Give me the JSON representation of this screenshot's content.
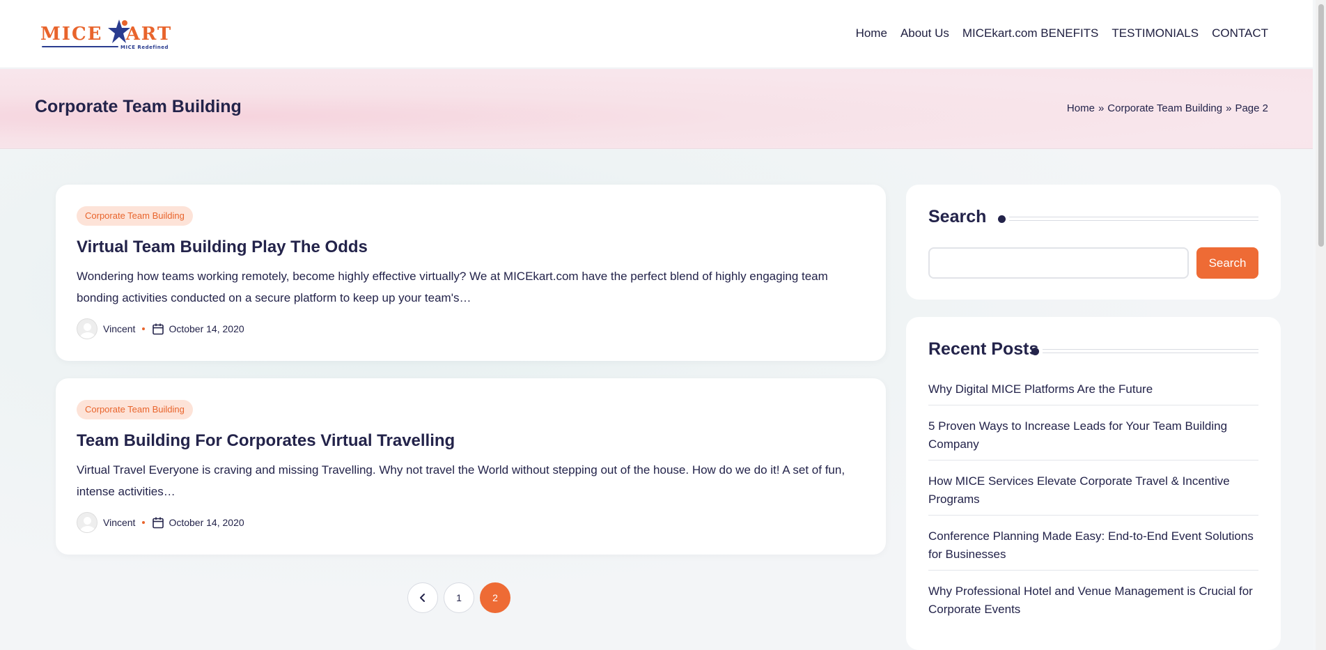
{
  "brand": {
    "logo_text": "MICE",
    "logo_text_end": "ART",
    "logo_tagline": "MICE Redefined",
    "accent": "#ee6b35",
    "dark": "#23234a"
  },
  "nav": {
    "items": [
      "Home",
      "About Us",
      "MICEkart.com BENEFITS",
      "TESTIMONIALS",
      "CONTACT"
    ]
  },
  "banner": {
    "title": "Corporate Team Building",
    "breadcrumb": [
      "Home",
      "»",
      "Corporate Team Building",
      "»",
      "Page 2"
    ]
  },
  "posts": [
    {
      "category": "Corporate Team Building",
      "title": "Virtual Team Building Play The Odds",
      "excerpt": "Wondering how teams working remotely, become highly effective virtually? We at MICEkart.com have the perfect blend of highly engaging team bonding activities conducted on a secure platform to keep up your team's…",
      "author": "Vincent",
      "date": "October 14, 2020"
    },
    {
      "category": "Corporate Team Building",
      "title": "Team Building For Corporates Virtual Travelling",
      "excerpt": "Virtual Travel Everyone is craving and missing Travelling. Why not travel the World without stepping out of the house. How do we do it! A set of fun, intense activities…",
      "author": "Vincent",
      "date": "October 14, 2020"
    }
  ],
  "pagination": {
    "pages": [
      "1",
      "2"
    ],
    "current": "2",
    "prev_icon": "chevron-left-icon"
  },
  "sidebar": {
    "search": {
      "title": "Search",
      "placeholder": "",
      "button_label": "Search"
    },
    "recent": {
      "title": "Recent Posts",
      "items": [
        "Why Digital MICE Platforms Are the Future",
        "5 Proven Ways to Increase Leads for Your Team Building Company",
        "How MICE Services Elevate Corporate Travel & Incentive Programs",
        "Conference Planning Made Easy: End-to-End Event Solutions for Businesses",
        "Why Professional Hotel and Venue Management is Crucial for Corporate Events"
      ]
    }
  }
}
